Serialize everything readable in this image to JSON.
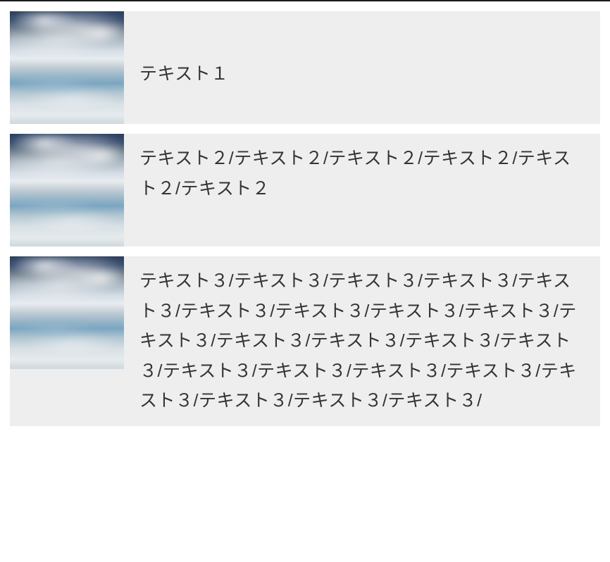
{
  "items": [
    {
      "text": "テキスト１"
    },
    {
      "text": "テキスト２/テキスト２/テキスト２/テキスト２/テキスト２/テキスト２"
    },
    {
      "text": "テキスト３/テキスト３/テキスト３/テキスト３/テキスト３/テキスト３/テキスト３/テキスト３/テキスト３/テキスト３/テキスト３/テキスト３/テキスト３/テキスト３/テキスト３/テキスト３/テキスト３/テキスト３/テキスト３/テキスト３/テキスト３/テキスト３/"
    }
  ]
}
